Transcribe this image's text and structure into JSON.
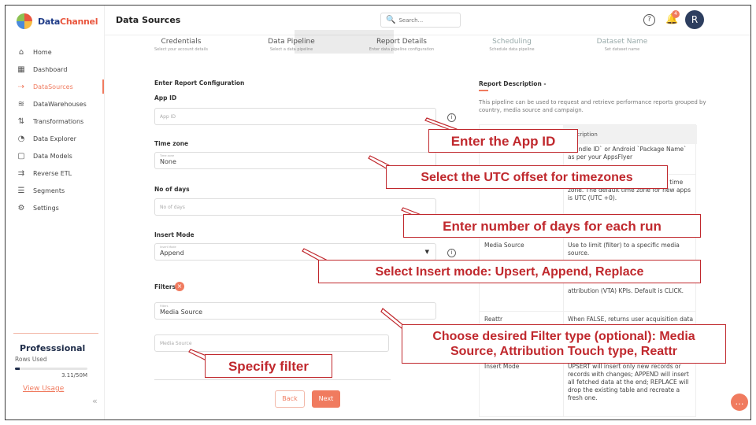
{
  "brand": {
    "name_part1": "Data",
    "name_part2": "Channel"
  },
  "sidebar": {
    "items": [
      {
        "label": "Home",
        "icon": "home-icon",
        "glyph": "⌂"
      },
      {
        "label": "Dashboard",
        "icon": "dashboard-icon",
        "glyph": "▦"
      },
      {
        "label": "DataSources",
        "icon": "datasources-icon",
        "glyph": "⇢"
      },
      {
        "label": "DataWarehouses",
        "icon": "layers-icon",
        "glyph": "≋"
      },
      {
        "label": "Transformations",
        "icon": "transform-icon",
        "glyph": "⇅"
      },
      {
        "label": "Data Explorer",
        "icon": "explorer-icon",
        "glyph": "◔"
      },
      {
        "label": "Data Models",
        "icon": "models-icon",
        "glyph": "▢"
      },
      {
        "label": "Reverse ETL",
        "icon": "reverse-etl-icon",
        "glyph": "⇉"
      },
      {
        "label": "Segments",
        "icon": "segments-icon",
        "glyph": "☰"
      },
      {
        "label": "Settings",
        "icon": "settings-icon",
        "glyph": "⚙"
      }
    ],
    "active_index": 2,
    "plan": {
      "name": "Professsional",
      "rows_label": "Rows Used",
      "usage_fraction": 0.06,
      "count": "3.11/50M",
      "link": "View Usage"
    },
    "collapse_glyph": "«"
  },
  "header": {
    "title": "Data Sources",
    "search_placeholder": "Search...",
    "help_glyph": "?",
    "bell_glyph": "🔔",
    "badge": "4",
    "avatar": "R"
  },
  "stepper": [
    {
      "title": "Credentials",
      "desc": "Select your account details"
    },
    {
      "title": "Data Pipeline",
      "desc": "Select a data pipeline"
    },
    {
      "title": "Report Details",
      "desc": "Enter data pipeline configuration"
    },
    {
      "title": "Scheduling",
      "desc": "Schedule data pipeline"
    },
    {
      "title": "Dataset Name",
      "desc": "Set dataset name"
    }
  ],
  "form": {
    "section_title": "Enter Report Configuration",
    "app_id": {
      "label": "App ID",
      "placeholder": "App ID"
    },
    "time_zone": {
      "label": "Time zone",
      "float_label": "Time zone",
      "value": "None"
    },
    "no_of_days": {
      "label": "No of days",
      "placeholder": "No of days"
    },
    "insert_mode": {
      "label": "Insert Mode",
      "float_label": "Insert Mode",
      "value": "Append",
      "caret": "▼"
    },
    "filters": {
      "label": "Filters",
      "remove_glyph": "×",
      "float_label": "Filters",
      "value": "Media Source",
      "sub_placeholder": "Media Source"
    },
    "info_glyph": "i",
    "back": "Back",
    "next": "Next"
  },
  "description": {
    "title": "Report Description -",
    "text": "This pipeline can be used to request and retrieve performance reports grouped by country, media source and campaign.",
    "table_head": "Description",
    "rows": [
      {
        "name": "",
        "desc": "`Bundle ID` or Android `Package Name` as per your AppsFlyer"
      },
      {
        "name": "",
        "desc": "...u view data aligned to a chosen time zone. The default time zone for new apps is UTC (UTC +0)."
      },
      {
        "name": "Media Source",
        "desc": "Use to limit (filter) to a specific media source."
      },
      {
        "name": "",
        "desc": "attribution (VTA) KPIs. Default is CLICK."
      },
      {
        "name": "Reattr",
        "desc": "When FALSE, returns user acquisition data (UA) and TRUE returns retargeting"
      },
      {
        "name": "Insert Mode",
        "desc": "UPSERT will insert only new records or records with changes; APPEND will insert all fetched data at the end; REPLACE will drop the existing table and recreate a fresh one."
      }
    ]
  },
  "callouts": {
    "app_id": "Enter the App ID",
    "timezone": "Select the UTC offset for timezones",
    "days": "Enter number of days for each run",
    "insert": "Select Insert mode: Upsert, Append, Replace",
    "filter_type_1": "Choose desired Filter type (optional): Media",
    "filter_type_2": "Source, Attribution Touch type, Reattr",
    "specify": "Specify filter"
  },
  "chat_glyph": "…"
}
